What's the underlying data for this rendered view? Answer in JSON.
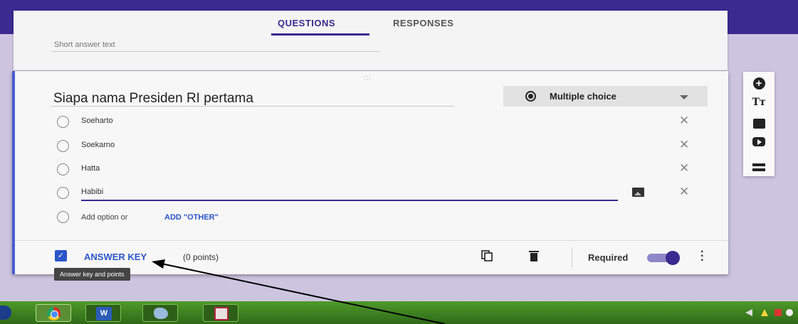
{
  "tabs": {
    "questions": "QUESTIONS",
    "responses": "RESPONSES"
  },
  "previous_question": {
    "short_answer": "Short answer text"
  },
  "question": {
    "drag_handle": ":::",
    "title": "Siapa nama Presiden RI pertama",
    "type": "Multiple choice",
    "options": [
      "Soeharto",
      "Soekarno",
      "Hatta",
      "Habibi"
    ],
    "add_option": "Add option",
    "or": "or",
    "add_other": "ADD \"OTHER\""
  },
  "footer": {
    "answer_key_check": "✓",
    "answer_key": "ANSWER KEY",
    "points": "(0 points)",
    "tooltip": "Answer key and points",
    "required": "Required",
    "required_on": true
  },
  "side_toolbar": {
    "add": "+",
    "text": "Tт"
  },
  "taskbar": {
    "word_label": "W"
  },
  "colors": {
    "brand": "#3b2a8f",
    "accent": "#2b55c8",
    "background": "#cdc5e0"
  },
  "icons": [
    "plus-circle-icon",
    "title-text-icon",
    "image-icon",
    "video-icon",
    "section-icon",
    "copy-icon",
    "trash-icon",
    "more-vert-icon",
    "close-icon"
  ]
}
